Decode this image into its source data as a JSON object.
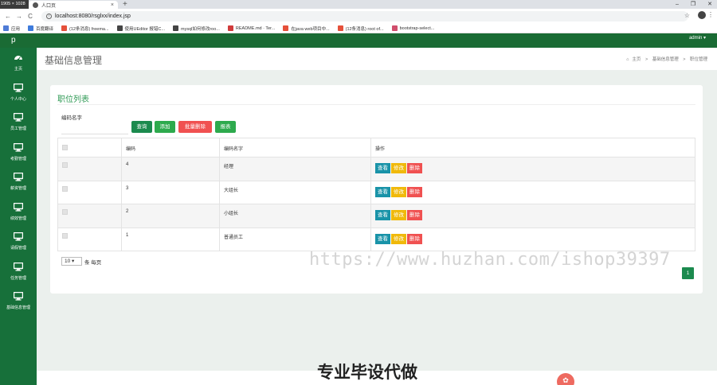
{
  "browser": {
    "resolution_badge": "1905 × 1028",
    "tab_title": "人口页",
    "tab_close": "×",
    "new_tab": "+",
    "url": "localhost:8080/rsglxx/index.jsp",
    "window_controls": [
      "–",
      "❐",
      "✕"
    ],
    "nav": [
      "←",
      "→",
      "C"
    ],
    "star": "☆",
    "bookmarks": [
      {
        "label": "应用",
        "icon_color": "#4f7bd6",
        "icon": "apps-icon"
      },
      {
        "label": "百度翻译",
        "icon_color": "#3e7bdc",
        "icon": "translate-icon"
      },
      {
        "label": "(12条消息) freema...",
        "icon_color": "#e5503a",
        "icon": "csdn-icon"
      },
      {
        "label": "使用UEditor 报错C...",
        "icon_color": "#444444",
        "icon": "site-icon"
      },
      {
        "label": "mysql如何修改roo...",
        "icon_color": "#444444",
        "icon": "site-icon"
      },
      {
        "label": "README.md · Ter...",
        "icon_color": "#d03b3b",
        "icon": "gitee-icon"
      },
      {
        "label": "在java web项目中...",
        "icon_color": "#e5503a",
        "icon": "csdn-icon"
      },
      {
        "label": "(12条消息) root of...",
        "icon_color": "#e5503a",
        "icon": "csdn-icon"
      },
      {
        "label": "bootstrap-select...",
        "icon_color": "#d04e6c",
        "icon": "site-icon"
      }
    ]
  },
  "app": {
    "logo_letter": "p",
    "user_menu": "admin ▾",
    "sidebar": [
      {
        "label": "主页",
        "icon": "dashboard-icon"
      },
      {
        "label": "个人中心",
        "icon": "monitor-icon"
      },
      {
        "label": "员工管理",
        "icon": "monitor-icon"
      },
      {
        "label": "考勤管理",
        "icon": "monitor-icon"
      },
      {
        "label": "薪资管理",
        "icon": "monitor-icon"
      },
      {
        "label": "绩效管理",
        "icon": "monitor-icon"
      },
      {
        "label": "请假管理",
        "icon": "monitor-icon"
      },
      {
        "label": "任务管理",
        "icon": "monitor-icon"
      },
      {
        "label": "基础信息管理",
        "icon": "monitor-icon"
      }
    ],
    "page_title": "基础信息管理",
    "breadcrumb": [
      "主页",
      "基础信息管理",
      "职位管理"
    ],
    "breadcrumb_sep": ">",
    "card_title": "职位列表",
    "search": {
      "label": "编码名字",
      "value": ""
    },
    "buttons": {
      "query": "查询",
      "add": "添加",
      "batch_delete": "批量删除",
      "report": "报表"
    },
    "table": {
      "headers": [
        "编码",
        "编码名字",
        "操作"
      ],
      "rows": [
        {
          "code": "4",
          "name": "经理"
        },
        {
          "code": "3",
          "name": "大组长"
        },
        {
          "code": "2",
          "name": "小组长"
        },
        {
          "code": "1",
          "name": "普通员工"
        }
      ],
      "row_actions": {
        "view": "查看",
        "edit": "修改",
        "delete": "删除"
      }
    },
    "page_size": {
      "value": "10",
      "suffix": "条 每页"
    },
    "current_page": "1"
  },
  "overlay": {
    "watermark": "https://www.huzhan.com/ishop39397",
    "promo": "专业毕设代做"
  },
  "colors": {
    "brand_green": "#1a6b34",
    "sidebar_green": "#17703a",
    "accent_green": "#2daa4d",
    "danger_red": "#f05151",
    "info_teal": "#1993a8",
    "warning_yellow": "#f0b90b"
  }
}
